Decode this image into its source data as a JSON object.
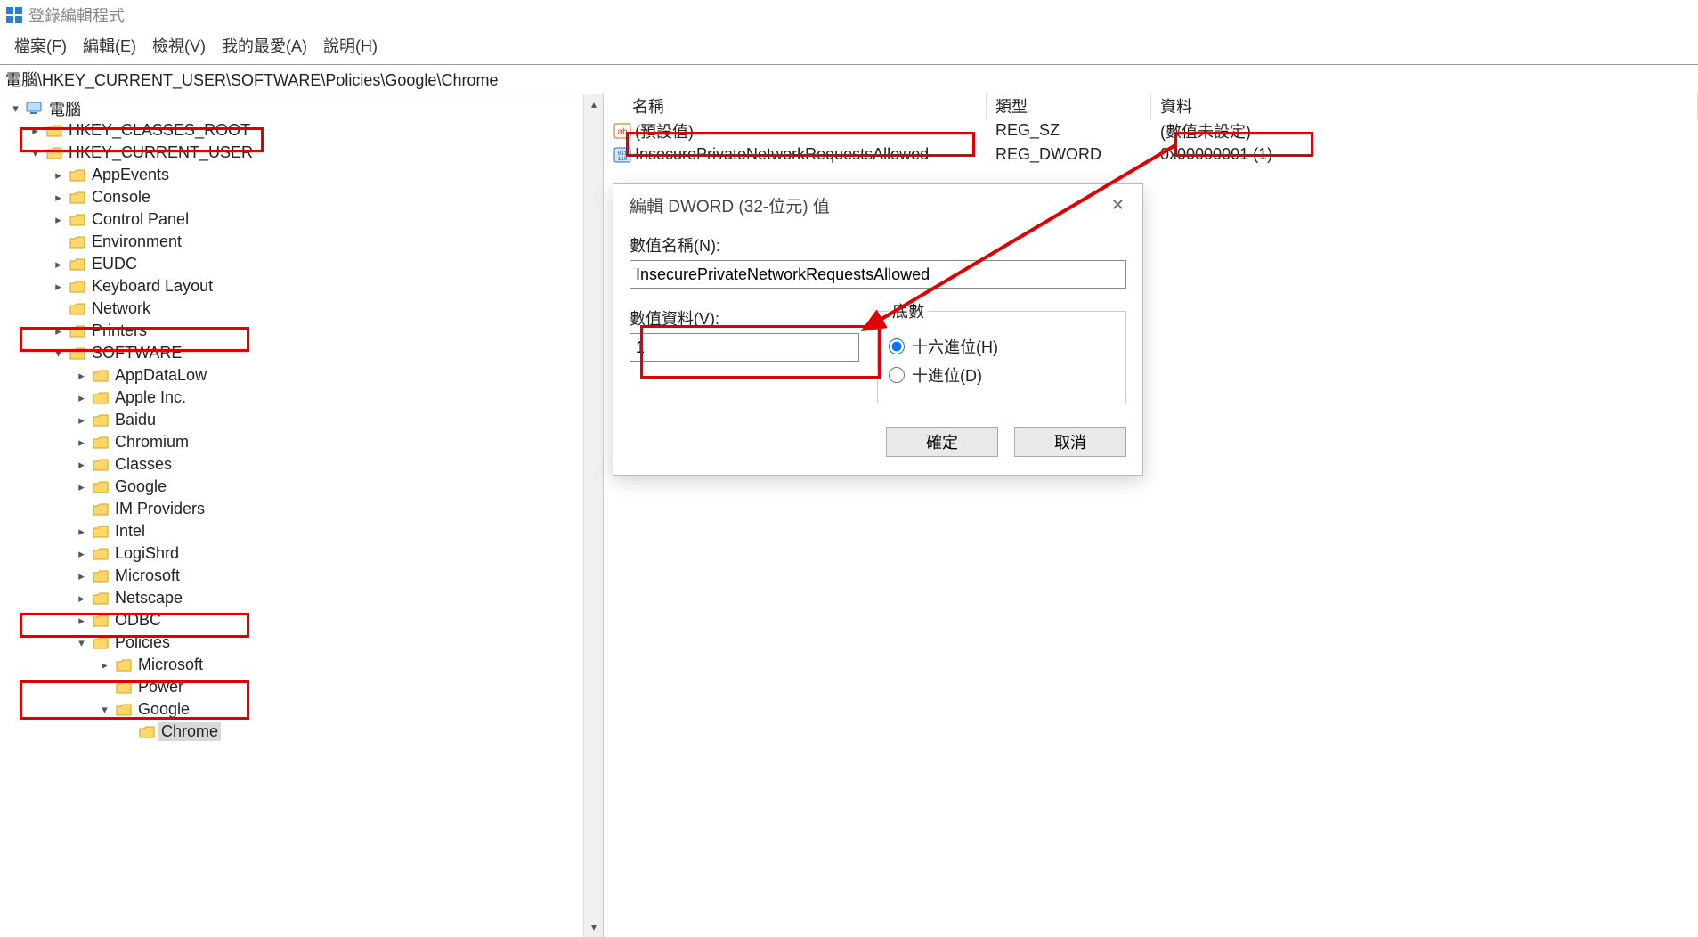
{
  "titlebar": {
    "title": "登錄編輯程式"
  },
  "menu": {
    "file": "檔案(F)",
    "edit": "編輯(E)",
    "view": "檢視(V)",
    "favorites": "我的最愛(A)",
    "help": "說明(H)"
  },
  "address": "電腦\\HKEY_CURRENT_USER\\SOFTWARE\\Policies\\Google\\Chrome",
  "tree": {
    "root": "電腦",
    "hkcr": "HKEY_CLASSES_ROOT",
    "hkcu": "HKEY_CURRENT_USER",
    "hkcu_children": {
      "appevents": "AppEvents",
      "console": "Console",
      "controlpanel": "Control Panel",
      "environment": "Environment",
      "eudc": "EUDC",
      "keyboard": "Keyboard Layout",
      "network": "Network",
      "printers": "Printers",
      "software": "SOFTWARE",
      "software_children": {
        "appdatalow": "AppDataLow",
        "apple": "Apple Inc.",
        "baidu": "Baidu",
        "chromium": "Chromium",
        "classes": "Classes",
        "google": "Google",
        "improviders": "IM Providers",
        "intel": "Intel",
        "logishrd": "LogiShrd",
        "microsoft": "Microsoft",
        "netscape": "Netscape",
        "odbc": "ODBC",
        "policies": "Policies",
        "policies_children": {
          "microsoft": "Microsoft",
          "power": "Power",
          "google": "Google",
          "google_children": {
            "chrome": "Chrome"
          }
        }
      }
    }
  },
  "list": {
    "headers": {
      "name": "名稱",
      "type": "類型",
      "data": "資料"
    },
    "rows": [
      {
        "name": "(預設值)",
        "type": "REG_SZ",
        "data": "(數值未設定)",
        "icon": "ab"
      },
      {
        "name": "InsecurePrivateNetworkRequestsAllowed",
        "type": "REG_DWORD",
        "data": "0x00000001 (1)",
        "icon": "bin"
      }
    ]
  },
  "dialog": {
    "title": "編輯 DWORD (32-位元) 值",
    "name_label": "數值名稱(N):",
    "name_value": "InsecurePrivateNetworkRequestsAllowed",
    "data_label": "數值資料(V):",
    "data_value": "1",
    "base_label": "底數",
    "hex_label": "十六進位(H)",
    "dec_label": "十進位(D)",
    "ok": "確定",
    "cancel": "取消"
  }
}
